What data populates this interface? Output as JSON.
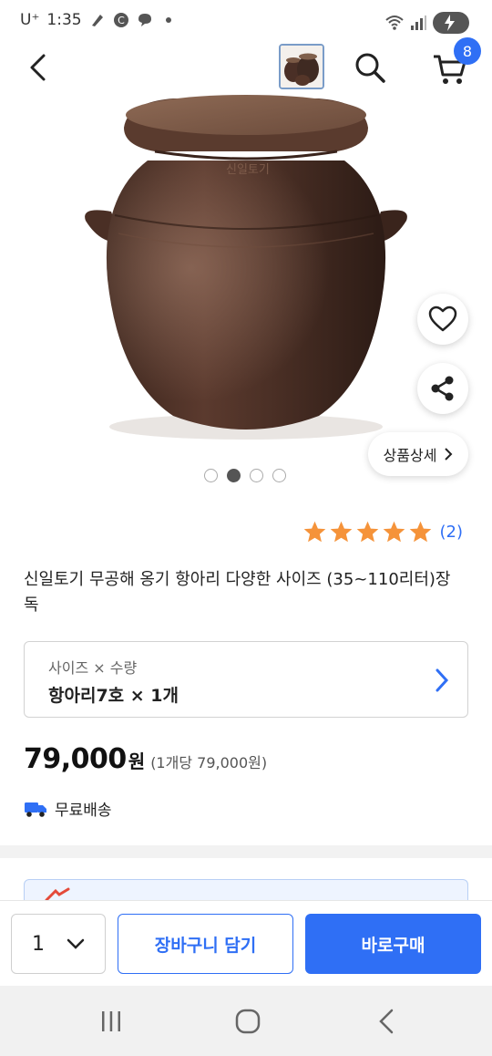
{
  "status_bar": {
    "carrier": "U⁺",
    "time": "1:35",
    "battery_icon": "battery-charging-icon",
    "wifi_icon": "wifi-icon",
    "signal_icon": "signal-icon"
  },
  "header": {
    "back_icon": "back-arrow-icon",
    "search_icon": "search-icon",
    "cart_icon": "cart-icon",
    "cart_count": "8"
  },
  "product": {
    "carousel_dots": 4,
    "carousel_active_index": 1,
    "detail_button_label": "상품상세",
    "rating_stars": 5,
    "review_count": "(2)",
    "title": "신일토기 무공해 옹기 항아리 다양한 사이즈 (35~110리터)장독",
    "option_label": "사이즈 × 수량",
    "option_value": "항아리7호 × 1개",
    "price": "79,000",
    "price_unit": "원",
    "unit_price": "(1개당 79,000원)",
    "shipping_label": "무료배송"
  },
  "buy_bar": {
    "quantity": "1",
    "add_to_cart_label": "장바구니 담기",
    "buy_now_label": "바로구매"
  },
  "colors": {
    "accent": "#2f6ff5",
    "star": "#f5933a",
    "jar_brown": "#4a2f26"
  }
}
